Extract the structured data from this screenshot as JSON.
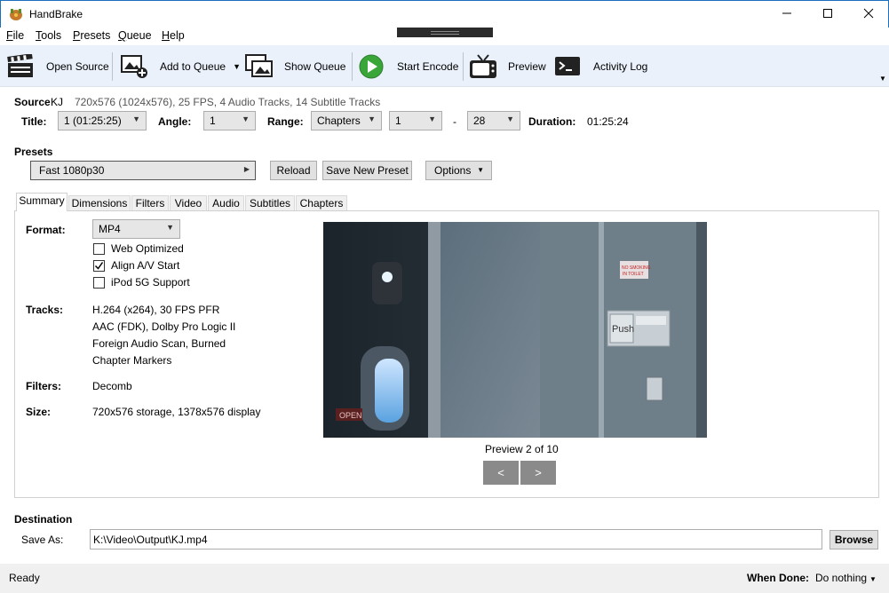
{
  "window": {
    "title": "HandBrake",
    "minimize": "—",
    "maximize": "☐",
    "close": "✕"
  },
  "menu": [
    {
      "label": "File",
      "u": "F",
      "rest": "ile"
    },
    {
      "label": "Tools",
      "u": "T",
      "rest": "ools"
    },
    {
      "label": "Presets",
      "u": "P",
      "rest": "resets"
    },
    {
      "label": "Queue",
      "u": "Q",
      "rest": "ueue"
    },
    {
      "label": "Help",
      "u": "H",
      "rest": "elp"
    }
  ],
  "toolbar": {
    "open_source": "Open Source",
    "add_to_queue": "Add to Queue",
    "show_queue": "Show Queue",
    "start_encode": "Start Encode",
    "preview": "Preview",
    "activity_log": "Activity Log"
  },
  "source": {
    "label": "Source",
    "name": "KJ",
    "info": "720x576 (1024x576), 25 FPS, 4 Audio Tracks, 14 Subtitle Tracks",
    "title_label": "Title:",
    "title_value": "1 (01:25:25)",
    "angle_label": "Angle:",
    "angle_value": "1",
    "range_label": "Range:",
    "range_type": "Chapters",
    "range_start": "1",
    "range_dash": "-",
    "range_end": "28",
    "duration_label": "Duration:",
    "duration_value": "01:25:24"
  },
  "presets": {
    "label": "Presets",
    "selected": "Fast 1080p30",
    "reload": "Reload",
    "save_new": "Save New Preset",
    "options": "Options"
  },
  "tabs": [
    "Summary",
    "Dimensions",
    "Filters",
    "Video",
    "Audio",
    "Subtitles",
    "Chapters"
  ],
  "summary": {
    "format_label": "Format:",
    "format_value": "MP4",
    "web_optimized": "Web Optimized",
    "web_optimized_checked": false,
    "align_av": "Align A/V Start",
    "align_av_checked": true,
    "ipod": "iPod 5G Support",
    "ipod_checked": false,
    "tracks_label": "Tracks:",
    "tracks": [
      "H.264 (x264), 30 FPS PFR",
      "AAC (FDK), Dolby Pro Logic II",
      "Foreign Audio Scan, Burned",
      "Chapter Markers"
    ],
    "filters_label": "Filters:",
    "filters_value": "Decomb",
    "size_label": "Size:",
    "size_value": "720x576 storage, 1378x576 display",
    "preview_caption": "Preview 2 of 10",
    "prev": "<",
    "next": ">",
    "preview_sign_1": "NO SMOKING",
    "preview_sign_2": "IN TOILET",
    "preview_push": "Push",
    "preview_open": "OPEN"
  },
  "destination": {
    "label": "Destination",
    "save_as_label": "Save As:",
    "path": "K:\\Video\\Output\\KJ.mp4",
    "browse": "Browse"
  },
  "status": {
    "text": "Ready",
    "when_done_label": "When Done:",
    "when_done_value": "Do nothing"
  }
}
